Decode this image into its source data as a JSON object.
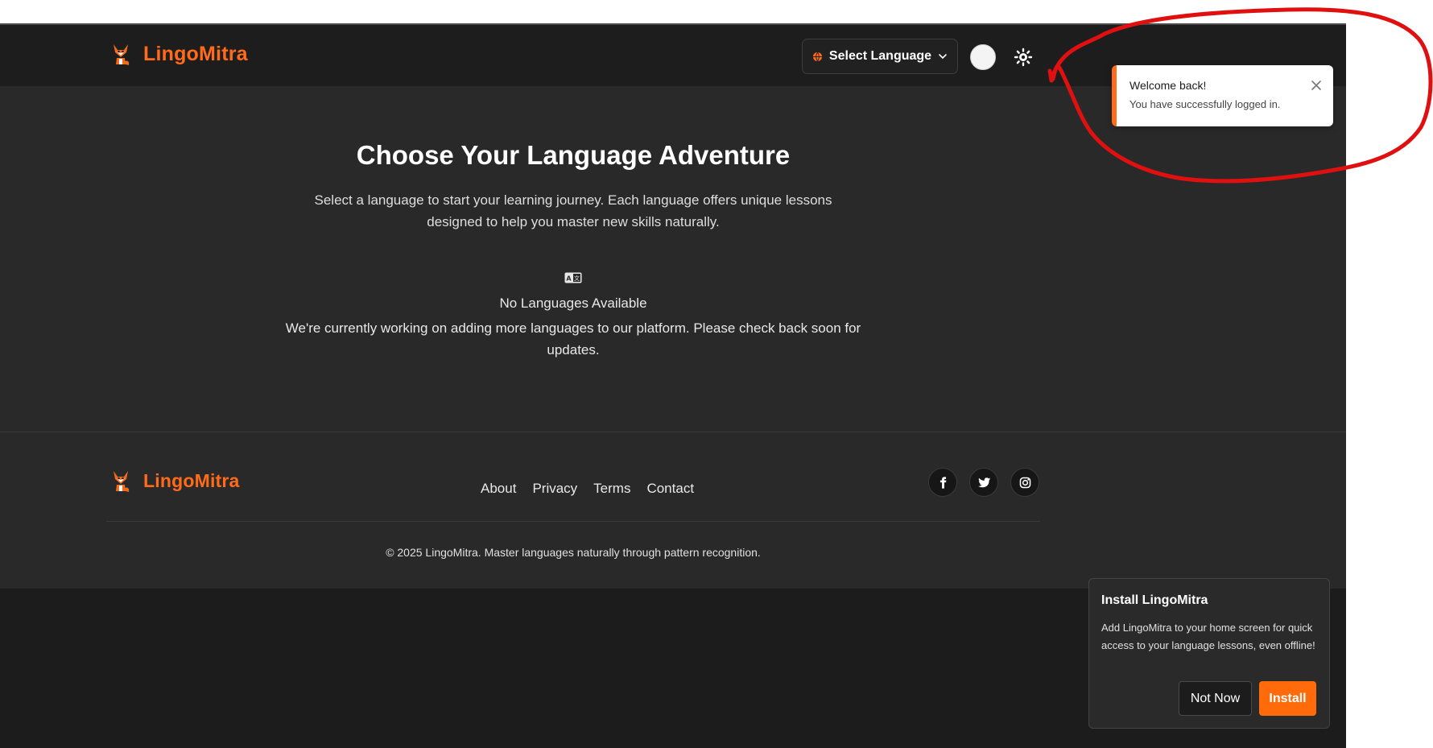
{
  "header": {
    "brand_name": "LingoMitra",
    "language_select_label": "Select Language",
    "avatar_initials": ""
  },
  "main": {
    "title": "Choose Your Language Adventure",
    "subtitle": "Select a language to start your learning journey. Each language offers unique lessons designed to help you master new skills naturally.",
    "empty_title": "No Languages Available",
    "empty_text": "We're currently working on adding more languages to our platform. Please check back soon for updates."
  },
  "footer": {
    "brand_name": "LingoMitra",
    "links": [
      "About",
      "Privacy",
      "Terms",
      "Contact"
    ],
    "socials": [
      "facebook-icon",
      "twitter-icon",
      "instagram-icon"
    ],
    "copyright": "© 2025 LingoMitra. Master languages naturally through pattern recognition."
  },
  "toast": {
    "title": "Welcome back!",
    "message": "You have successfully logged in."
  },
  "install_prompt": {
    "title": "Install LingoMitra",
    "text": "Add LingoMitra to your home screen for quick access to your language lessons, even offline!",
    "not_now_label": "Not Now",
    "install_label": "Install"
  },
  "colors": {
    "accent": "#ff6b1a",
    "background": "#1c1c1c",
    "surface": "#292929",
    "annotation": "#e01010"
  }
}
